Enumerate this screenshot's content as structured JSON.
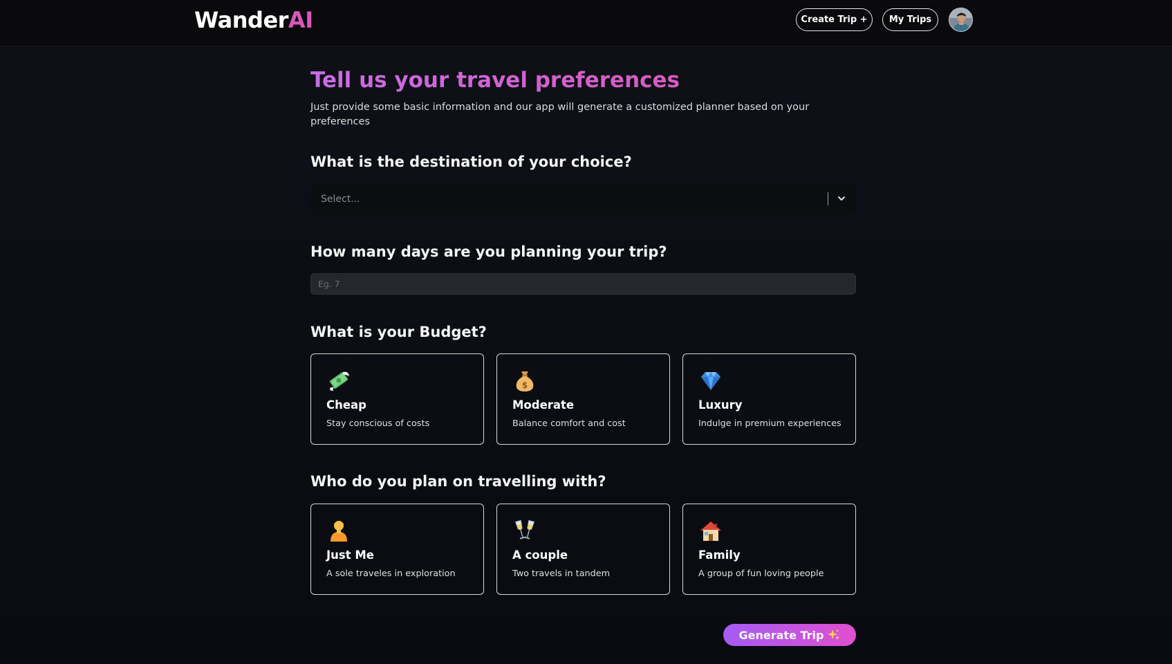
{
  "header": {
    "logo_main": "Wander",
    "logo_accent": "AI",
    "create_trip_label": "Create Trip +",
    "my_trips_label": "My Trips"
  },
  "intro": {
    "title": "Tell us your travel preferences",
    "subtitle": "Just provide some basic information and our app will generate a customized planner based on your preferences"
  },
  "destination": {
    "question": "What is the destination of your choice?",
    "placeholder": "Select..."
  },
  "days": {
    "question": "How many days are you planning your trip?",
    "placeholder": "Eg. 7"
  },
  "budget": {
    "question": "What is your Budget?",
    "options": [
      {
        "icon": "money-wings-icon",
        "title": "Cheap",
        "desc": "Stay conscious of costs"
      },
      {
        "icon": "money-bag-icon",
        "title": "Moderate",
        "desc": "Balance comfort and cost"
      },
      {
        "icon": "gem-icon",
        "title": "Luxury",
        "desc": "Indulge in premium experiences"
      }
    ]
  },
  "travellers": {
    "question": "Who do you plan on travelling with?",
    "options": [
      {
        "icon": "person-icon",
        "title": "Just Me",
        "desc": "A sole traveles in exploration"
      },
      {
        "icon": "champagne-glasses-icon",
        "title": "A couple",
        "desc": "Two travels in tandem"
      },
      {
        "icon": "house-icon",
        "title": "Family",
        "desc": "A group of fun loving people"
      }
    ]
  },
  "generate": {
    "label": "Generate Trip",
    "icon": "sparkles-icon"
  },
  "colors": {
    "background": "#0b0d13",
    "accent_pink": "#d957b8",
    "accent_purple": "#a45cf2",
    "card_border": "#d9d9d9"
  }
}
